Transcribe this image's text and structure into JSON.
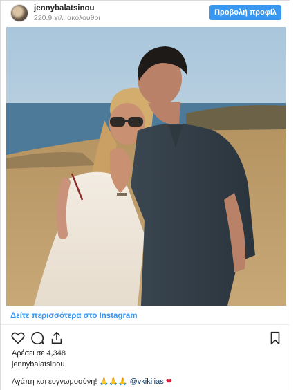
{
  "header": {
    "username": "jennybalatsinou",
    "followers": "220.9 χιλ. ακόλουθοι",
    "profile_button": "Προβολή προφίλ"
  },
  "post": {
    "see_more": "Δείτε περισσότερα στο Instagram",
    "likes": "Αρέσει σε 4,348",
    "owner": "jennybalatsinou",
    "caption_text": "Αγάπη και ευγνωμοσύνη! ",
    "caption_emojis": "🙏🙏🙏 ",
    "caption_mention": "@vkikilias",
    "caption_heart": " ❤"
  },
  "icons": {
    "like": "heart-outline-icon",
    "comment": "comment-bubble-icon",
    "share": "share-upload-icon",
    "save": "bookmark-icon"
  },
  "colors": {
    "accent_blue": "#3897f0",
    "mention": "#003569",
    "heart": "#d81b3c"
  }
}
